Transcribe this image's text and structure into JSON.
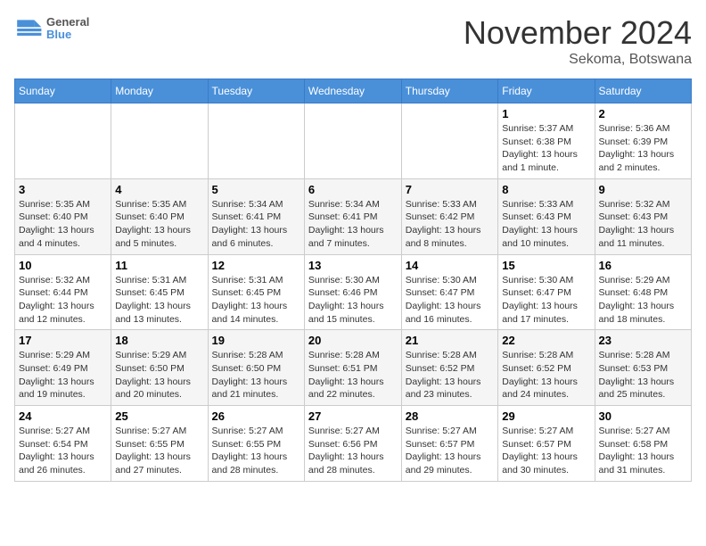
{
  "header": {
    "logo_line1": "General",
    "logo_line2": "Blue",
    "title": "November 2024",
    "subtitle": "Sekoma, Botswana"
  },
  "weekdays": [
    "Sunday",
    "Monday",
    "Tuesday",
    "Wednesday",
    "Thursday",
    "Friday",
    "Saturday"
  ],
  "weeks": [
    [
      {
        "day": "",
        "info": ""
      },
      {
        "day": "",
        "info": ""
      },
      {
        "day": "",
        "info": ""
      },
      {
        "day": "",
        "info": ""
      },
      {
        "day": "",
        "info": ""
      },
      {
        "day": "1",
        "info": "Sunrise: 5:37 AM\nSunset: 6:38 PM\nDaylight: 13 hours and 1 minute."
      },
      {
        "day": "2",
        "info": "Sunrise: 5:36 AM\nSunset: 6:39 PM\nDaylight: 13 hours and 2 minutes."
      }
    ],
    [
      {
        "day": "3",
        "info": "Sunrise: 5:35 AM\nSunset: 6:40 PM\nDaylight: 13 hours and 4 minutes."
      },
      {
        "day": "4",
        "info": "Sunrise: 5:35 AM\nSunset: 6:40 PM\nDaylight: 13 hours and 5 minutes."
      },
      {
        "day": "5",
        "info": "Sunrise: 5:34 AM\nSunset: 6:41 PM\nDaylight: 13 hours and 6 minutes."
      },
      {
        "day": "6",
        "info": "Sunrise: 5:34 AM\nSunset: 6:41 PM\nDaylight: 13 hours and 7 minutes."
      },
      {
        "day": "7",
        "info": "Sunrise: 5:33 AM\nSunset: 6:42 PM\nDaylight: 13 hours and 8 minutes."
      },
      {
        "day": "8",
        "info": "Sunrise: 5:33 AM\nSunset: 6:43 PM\nDaylight: 13 hours and 10 minutes."
      },
      {
        "day": "9",
        "info": "Sunrise: 5:32 AM\nSunset: 6:43 PM\nDaylight: 13 hours and 11 minutes."
      }
    ],
    [
      {
        "day": "10",
        "info": "Sunrise: 5:32 AM\nSunset: 6:44 PM\nDaylight: 13 hours and 12 minutes."
      },
      {
        "day": "11",
        "info": "Sunrise: 5:31 AM\nSunset: 6:45 PM\nDaylight: 13 hours and 13 minutes."
      },
      {
        "day": "12",
        "info": "Sunrise: 5:31 AM\nSunset: 6:45 PM\nDaylight: 13 hours and 14 minutes."
      },
      {
        "day": "13",
        "info": "Sunrise: 5:30 AM\nSunset: 6:46 PM\nDaylight: 13 hours and 15 minutes."
      },
      {
        "day": "14",
        "info": "Sunrise: 5:30 AM\nSunset: 6:47 PM\nDaylight: 13 hours and 16 minutes."
      },
      {
        "day": "15",
        "info": "Sunrise: 5:30 AM\nSunset: 6:47 PM\nDaylight: 13 hours and 17 minutes."
      },
      {
        "day": "16",
        "info": "Sunrise: 5:29 AM\nSunset: 6:48 PM\nDaylight: 13 hours and 18 minutes."
      }
    ],
    [
      {
        "day": "17",
        "info": "Sunrise: 5:29 AM\nSunset: 6:49 PM\nDaylight: 13 hours and 19 minutes."
      },
      {
        "day": "18",
        "info": "Sunrise: 5:29 AM\nSunset: 6:50 PM\nDaylight: 13 hours and 20 minutes."
      },
      {
        "day": "19",
        "info": "Sunrise: 5:28 AM\nSunset: 6:50 PM\nDaylight: 13 hours and 21 minutes."
      },
      {
        "day": "20",
        "info": "Sunrise: 5:28 AM\nSunset: 6:51 PM\nDaylight: 13 hours and 22 minutes."
      },
      {
        "day": "21",
        "info": "Sunrise: 5:28 AM\nSunset: 6:52 PM\nDaylight: 13 hours and 23 minutes."
      },
      {
        "day": "22",
        "info": "Sunrise: 5:28 AM\nSunset: 6:52 PM\nDaylight: 13 hours and 24 minutes."
      },
      {
        "day": "23",
        "info": "Sunrise: 5:28 AM\nSunset: 6:53 PM\nDaylight: 13 hours and 25 minutes."
      }
    ],
    [
      {
        "day": "24",
        "info": "Sunrise: 5:27 AM\nSunset: 6:54 PM\nDaylight: 13 hours and 26 minutes."
      },
      {
        "day": "25",
        "info": "Sunrise: 5:27 AM\nSunset: 6:55 PM\nDaylight: 13 hours and 27 minutes."
      },
      {
        "day": "26",
        "info": "Sunrise: 5:27 AM\nSunset: 6:55 PM\nDaylight: 13 hours and 28 minutes."
      },
      {
        "day": "27",
        "info": "Sunrise: 5:27 AM\nSunset: 6:56 PM\nDaylight: 13 hours and 28 minutes."
      },
      {
        "day": "28",
        "info": "Sunrise: 5:27 AM\nSunset: 6:57 PM\nDaylight: 13 hours and 29 minutes."
      },
      {
        "day": "29",
        "info": "Sunrise: 5:27 AM\nSunset: 6:57 PM\nDaylight: 13 hours and 30 minutes."
      },
      {
        "day": "30",
        "info": "Sunrise: 5:27 AM\nSunset: 6:58 PM\nDaylight: 13 hours and 31 minutes."
      }
    ]
  ]
}
